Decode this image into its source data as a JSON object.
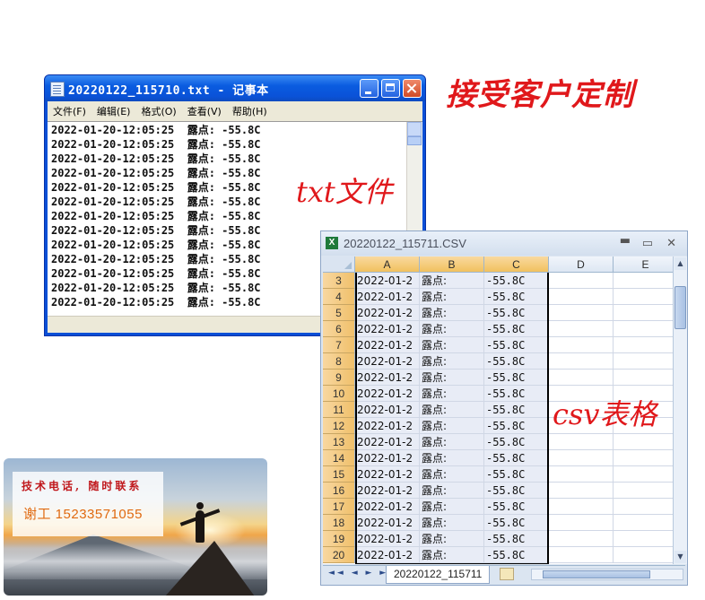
{
  "notepad": {
    "title": "20220122_115710.txt - 记事本",
    "menu": [
      "文件(F)",
      "编辑(E)",
      "格式(O)",
      "查看(V)",
      "帮助(H)"
    ],
    "lines": [
      "2022-01-20-12:05:25  露点: -55.8C",
      "2022-01-20-12:05:25  露点: -55.8C",
      "2022-01-20-12:05:25  露点: -55.8C",
      "2022-01-20-12:05:25  露点: -55.8C",
      "2022-01-20-12:05:25  露点: -55.8C",
      "2022-01-20-12:05:25  露点: -55.8C",
      "2022-01-20-12:05:25  露点: -55.8C",
      "2022-01-20-12:05:25  露点: -55.8C",
      "2022-01-20-12:05:25  露点: -55.8C",
      "2022-01-20-12:05:25  露点: -55.8C",
      "2022-01-20-12:05:25  露点: -55.8C",
      "2022-01-20-12:05:25  露点: -55.8C",
      "2022-01-20-12:05:25  露点: -55.8C"
    ]
  },
  "excel": {
    "title": "20220122_115711.CSV",
    "controls": {
      "minimize": "▬",
      "maximize": "▭",
      "close": "✕"
    },
    "columns": [
      "A",
      "B",
      "C",
      "D",
      "E"
    ],
    "rows": [
      {
        "num": "3",
        "a": "2022-01-2",
        "b": "露点:",
        "c": "-55.8C"
      },
      {
        "num": "4",
        "a": "2022-01-2",
        "b": "露点:",
        "c": "-55.8C"
      },
      {
        "num": "5",
        "a": "2022-01-2",
        "b": "露点:",
        "c": "-55.8C"
      },
      {
        "num": "6",
        "a": "2022-01-2",
        "b": "露点:",
        "c": "-55.8C"
      },
      {
        "num": "7",
        "a": "2022-01-2",
        "b": "露点:",
        "c": "-55.8C"
      },
      {
        "num": "8",
        "a": "2022-01-2",
        "b": "露点:",
        "c": "-55.8C"
      },
      {
        "num": "9",
        "a": "2022-01-2",
        "b": "露点:",
        "c": "-55.8C"
      },
      {
        "num": "10",
        "a": "2022-01-2",
        "b": "露点:",
        "c": "-55.8C"
      },
      {
        "num": "11",
        "a": "2022-01-2",
        "b": "露点:",
        "c": "-55.8C"
      },
      {
        "num": "12",
        "a": "2022-01-2",
        "b": "露点:",
        "c": "-55.8C"
      },
      {
        "num": "13",
        "a": "2022-01-2",
        "b": "露点:",
        "c": "-55.8C"
      },
      {
        "num": "14",
        "a": "2022-01-2",
        "b": "露点:",
        "c": "-55.8C"
      },
      {
        "num": "15",
        "a": "2022-01-2",
        "b": "露点:",
        "c": "-55.8C"
      },
      {
        "num": "16",
        "a": "2022-01-2",
        "b": "露点:",
        "c": "-55.8C"
      },
      {
        "num": "17",
        "a": "2022-01-2",
        "b": "露点:",
        "c": "-55.8C"
      },
      {
        "num": "18",
        "a": "2022-01-2",
        "b": "露点:",
        "c": "-55.8C"
      },
      {
        "num": "19",
        "a": "2022-01-2",
        "b": "露点:",
        "c": "-55.8C"
      },
      {
        "num": "20",
        "a": "2022-01-2",
        "b": "露点:",
        "c": "-55.8C"
      }
    ],
    "sheet_tab": "20220122_115711",
    "tab_nav": "◄◄ ◄ ► ►►"
  },
  "annotations": {
    "custom": "接受客户定制",
    "txt": "txt文件",
    "csv": "csv表格"
  },
  "contact": {
    "line1": "技术电话, 随时联系",
    "line2": "谢工 15233571055"
  },
  "colors": {
    "annotation": "#e0181b",
    "xp_title_blue": "#0a5ce0",
    "excel_header_selected": "#f1c15f"
  }
}
